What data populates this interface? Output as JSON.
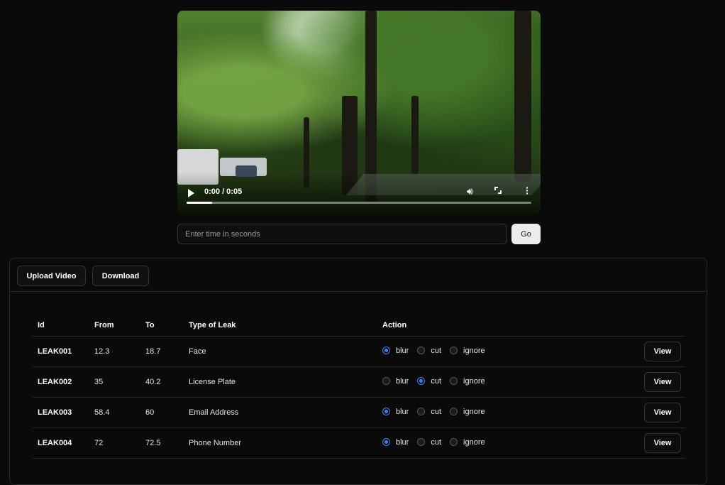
{
  "video": {
    "time_display": "0:00 / 0:05",
    "progress": 0.075
  },
  "seek": {
    "placeholder": "Enter time in seconds",
    "go_label": "Go"
  },
  "toolbar": {
    "upload_label": "Upload Video",
    "download_label": "Download"
  },
  "table": {
    "headers": {
      "id": "Id",
      "from": "From",
      "to": "To",
      "type": "Type of Leak",
      "action": "Action"
    },
    "option_labels": {
      "blur": "blur",
      "cut": "cut",
      "ignore": "ignore"
    },
    "view_label": "View",
    "rows": [
      {
        "id": "LEAK001",
        "from": "12.3",
        "to": "18.7",
        "type": "Face",
        "action": "blur"
      },
      {
        "id": "LEAK002",
        "from": "35",
        "to": "40.2",
        "type": "License Plate",
        "action": "cut"
      },
      {
        "id": "LEAK003",
        "from": "58.4",
        "to": "60",
        "type": "Email Address",
        "action": "blur"
      },
      {
        "id": "LEAK004",
        "from": "72",
        "to": "72.5",
        "type": "Phone Number",
        "action": "blur"
      }
    ]
  },
  "colors": {
    "background": "#0a0a0a",
    "accent": "#3b82f6",
    "border": "#2a2a2a"
  },
  "icons": [
    "play-icon",
    "volume-icon",
    "fullscreen-icon",
    "more-options-icon"
  ]
}
